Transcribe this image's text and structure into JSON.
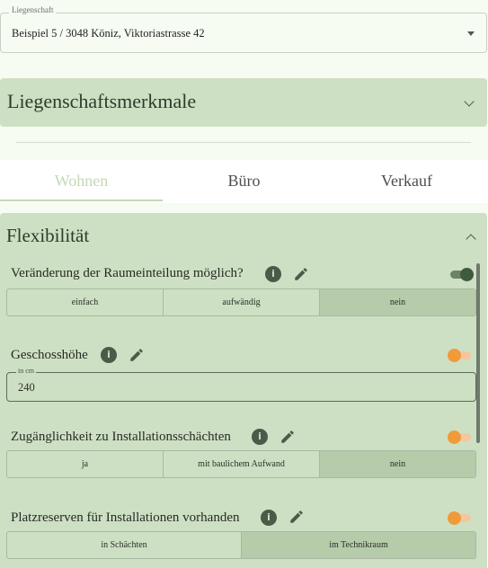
{
  "property": {
    "legend": "Liegenschaft",
    "value": "Beispiel 5 / 3048 Köniz, Viktoriastrasse 42"
  },
  "features_panel": {
    "title": "Liegenschaftsmerkmale"
  },
  "tabs": [
    {
      "label": "Wohnen",
      "active": true
    },
    {
      "label": "Büro",
      "active": false
    },
    {
      "label": "Verkauf",
      "active": false
    }
  ],
  "section": {
    "title": "Flexibilität",
    "questions": [
      {
        "label": "Veränderung der Raumeinteilung möglich?",
        "toggle": "on",
        "options": [
          "einfach",
          "aufwändig",
          "nein"
        ],
        "selected": "nein"
      },
      {
        "label": "Geschosshöhe",
        "toggle": "off",
        "field_legend": "in cm",
        "value": "240"
      },
      {
        "label": "Zugänglichkeit zu Installationsschächten",
        "toggle": "off",
        "options": [
          "ja",
          "mit baulichem Aufwand",
          "nein"
        ],
        "selected": "nein"
      },
      {
        "label": "Platzreserven für Installationen vorhanden",
        "toggle": "off",
        "options": [
          "in Schächten",
          "im Technikraum"
        ],
        "selected": "im Technikraum"
      }
    ]
  },
  "icons": {
    "info": "info-icon",
    "edit": "pencil-icon"
  },
  "colors": {
    "panel": "#cee0c3",
    "toggle_on": "#3f5a3c",
    "toggle_off": "#f09a3a"
  }
}
